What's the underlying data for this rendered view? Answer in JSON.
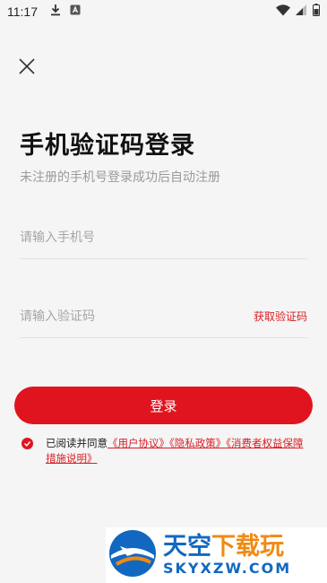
{
  "status_bar": {
    "time": "11:17",
    "icons": [
      "download-icon",
      "a-badge-icon",
      "wifi-icon",
      "signal-icon",
      "battery-icon"
    ]
  },
  "header": {
    "close_icon": "close-icon"
  },
  "main": {
    "title": "手机验证码登录",
    "subtitle": "未注册的手机号登录成功后自动注册",
    "phone_placeholder": "请输入手机号",
    "phone_value": "",
    "code_placeholder": "请输入验证码",
    "code_value": "",
    "get_code_label": "获取验证码",
    "login_label": "登录"
  },
  "agreement": {
    "checked": true,
    "prefix": "已阅读并同意",
    "user_agreement": "《用户协议》",
    "privacy_policy": "《隐私政策》",
    "consumer_rights": "《消费者权益保障措施说明》"
  },
  "watermark": {
    "title_part1": "天空",
    "title_part2": "下载玩",
    "domain": "SKYXZW.COM"
  },
  "colors": {
    "accent": "#e0141e",
    "background": "#f5f5f5",
    "watermark_blue": "#1268c0",
    "watermark_orange": "#f08a12"
  }
}
